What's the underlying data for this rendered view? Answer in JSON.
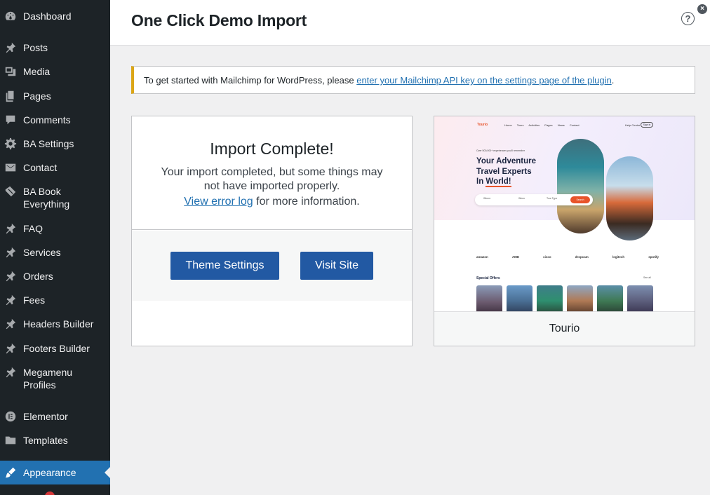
{
  "sidebar": {
    "items": [
      {
        "label": "Dashboard",
        "icon": "dashboard-icon"
      },
      {
        "label": "Posts",
        "icon": "pin-icon"
      },
      {
        "label": "Media",
        "icon": "media-icon"
      },
      {
        "label": "Pages",
        "icon": "pages-icon"
      },
      {
        "label": "Comments",
        "icon": "comment-icon"
      },
      {
        "label": "BA Settings",
        "icon": "gear-icon"
      },
      {
        "label": "Contact",
        "icon": "mail-icon"
      },
      {
        "label": "BA Book Everything",
        "icon": "ticket-icon"
      },
      {
        "label": "FAQ",
        "icon": "pin-icon"
      },
      {
        "label": "Services",
        "icon": "pin-icon"
      },
      {
        "label": "Orders",
        "icon": "pin-icon"
      },
      {
        "label": "Fees",
        "icon": "pin-icon"
      },
      {
        "label": "Headers Builder",
        "icon": "pin-icon"
      },
      {
        "label": "Footers Builder",
        "icon": "pin-icon"
      },
      {
        "label": "Megamenu Profiles",
        "icon": "pin-icon"
      },
      {
        "label": "Elementor",
        "icon": "elementor-icon"
      },
      {
        "label": "Templates",
        "icon": "folder-icon"
      },
      {
        "label": "Appearance",
        "icon": "brush-icon",
        "active": true
      }
    ]
  },
  "header": {
    "title": "One Click Demo Import",
    "help_glyph": "?",
    "close_glyph": "×"
  },
  "notice": {
    "text": "To get started with Mailchimp for WordPress, please ",
    "link": "enter your Mailchimp API key on the settings page of the plugin",
    "suffix": "."
  },
  "import": {
    "title": "Import Complete!",
    "description": "Your import completed, but some things may not have imported properly.",
    "log_link": "View error log",
    "log_suffix": " for more information.",
    "theme_settings_label": "Theme Settings",
    "visit_site_label": "Visit Site"
  },
  "demo": {
    "name": "Tourio",
    "preview": {
      "logo": "Tourio",
      "nav": "Home Tours Activities Pages News Contact",
      "help": "Help Center",
      "signin": "Sign in",
      "tagline": "Over 500,000+ experiences you'll remember",
      "hero_line1": "Your Adventure",
      "hero_line2": "Travel Experts",
      "hero_line3_a": "In ",
      "hero_line3_b": "World!",
      "search_where": "Where",
      "search_when": "When",
      "search_type": "Tour Type",
      "search_btn": "Search",
      "logos": [
        "amazon",
        "AMD",
        "cisco",
        "dropcam",
        "logitech",
        "spotify"
      ],
      "offers_title": "Special Offers",
      "offers_more": "See all"
    }
  },
  "colors": {
    "sidebar_bg": "#1d2327",
    "active_bg": "#2271b1",
    "button_bg": "#2259a3",
    "notice_accent": "#dba617",
    "link": "#2271b1",
    "brand_orange": "#e8542a"
  }
}
